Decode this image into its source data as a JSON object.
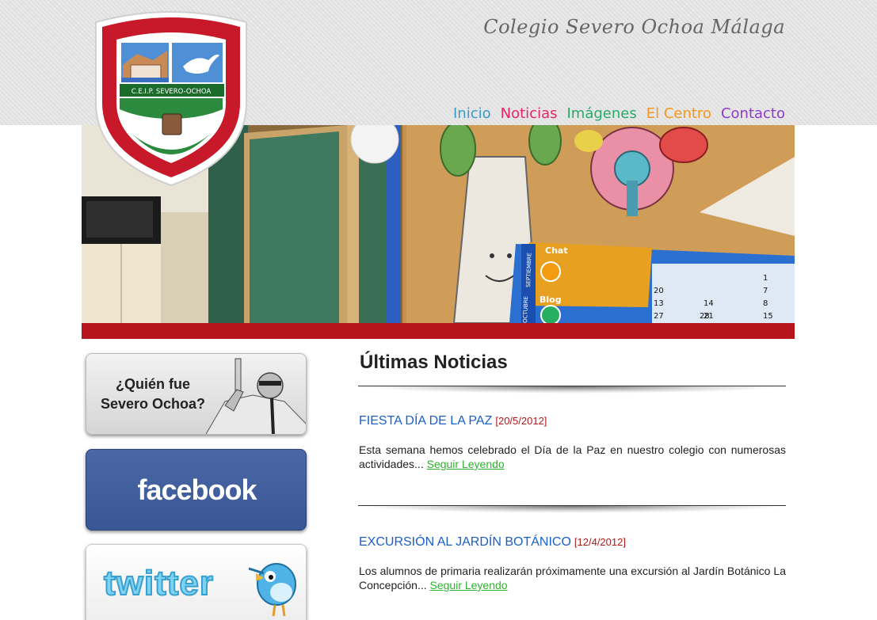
{
  "header": {
    "site_title": "Colegio Severo Ochoa Málaga",
    "crest_text": "C.E.I.P. SEVERO-OCHOA"
  },
  "nav": {
    "items": [
      {
        "label": "Inicio",
        "color": "#3a9bc8"
      },
      {
        "label": "Noticias",
        "color": "#e8236a"
      },
      {
        "label": "Imágenes",
        "color": "#2aa86b"
      },
      {
        "label": "El Centro",
        "color": "#f5941e"
      },
      {
        "label": "Contacto",
        "color": "#8e3bc4"
      }
    ]
  },
  "hero": {
    "chat_label": "Chat",
    "blog_label": "Blog",
    "september_label": "SEPTIEMBRE",
    "october_label": "OCTUBRE",
    "calendar_numbers": [
      "20",
      "13",
      "27",
      "14",
      "21",
      "7",
      "28",
      "8",
      "15",
      "1"
    ]
  },
  "sidebar": {
    "ochoa_label": "¿Quién fue Severo Ochoa?",
    "facebook_label": "facebook",
    "twitter_label": "twitter"
  },
  "main": {
    "section_title": "Últimas Noticias",
    "news": [
      {
        "title": "FIESTA DÍA DE LA PAZ",
        "date": "[20/5/2012]",
        "body": "Esta semana hemos celebrado el Día de la Paz en nuestro colegio con numerosas actividades...",
        "read_more": "Seguir Leyendo"
      },
      {
        "title": "EXCURSIÓN AL JARDÍN BOTÁNICO",
        "date": "[12/4/2012]",
        "body": "Los alumnos de primaria realizarán próximamente una excursión al Jardín Botánico La Concepción...",
        "read_more": "Seguir Leyendo"
      }
    ]
  },
  "colors": {
    "brand_red": "#b5151b",
    "link_blue": "#1a5fc8",
    "date_red": "#b11a1a",
    "read_more_green": "#2db32d"
  }
}
